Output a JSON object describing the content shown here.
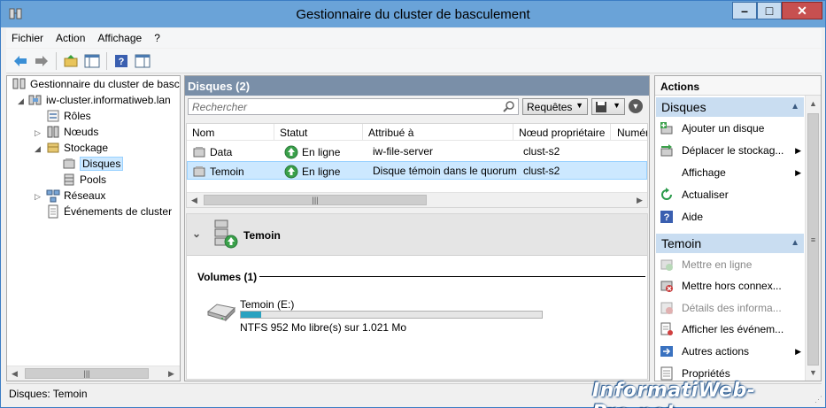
{
  "window": {
    "title": "Gestionnaire du cluster de basculement"
  },
  "menu": [
    "Fichier",
    "Action",
    "Affichage",
    "?"
  ],
  "tree": {
    "root": "Gestionnaire du cluster de basculement",
    "cluster": "iw-cluster.informatiweb.lan",
    "roles": "Rôles",
    "nodes": "Nœuds",
    "storage": "Stockage",
    "disks": "Disques",
    "pools": "Pools",
    "networks": "Réseaux",
    "events": "Événements de cluster"
  },
  "center": {
    "header": "Disques (2)",
    "search_placeholder": "Rechercher",
    "queries_label": "Requêtes",
    "columns": [
      "Nom",
      "Statut",
      "Attribué à",
      "Nœud propriétaire",
      "Numéro"
    ],
    "rows": [
      {
        "name": "Data",
        "status": "En ligne",
        "assigned": "iw-file-server",
        "owner": "clust-s2"
      },
      {
        "name": "Temoin",
        "status": "En ligne",
        "assigned": "Disque témoin dans le quorum",
        "owner": "clust-s2"
      }
    ]
  },
  "detail": {
    "name": "Temoin",
    "volumes_header": "Volumes (1)",
    "volume_name": "Temoin (E:)",
    "volume_info": "NTFS 952 Mo libre(s) sur 1.021 Mo",
    "used_fraction": 0.068
  },
  "actions": {
    "header": "Actions",
    "sections": [
      {
        "title": "Disques",
        "items": [
          {
            "label": "Ajouter un disque",
            "icon": "add-disk-icon",
            "enabled": true,
            "submenu": false
          },
          {
            "label": "Déplacer le stockag...",
            "icon": "move-storage-icon",
            "enabled": true,
            "submenu": true
          },
          {
            "label": "Affichage",
            "icon": "none",
            "enabled": true,
            "submenu": true
          },
          {
            "label": "Actualiser",
            "icon": "refresh-icon",
            "enabled": true,
            "submenu": false
          },
          {
            "label": "Aide",
            "icon": "help-icon",
            "enabled": true,
            "submenu": false
          }
        ]
      },
      {
        "title": "Temoin",
        "items": [
          {
            "label": "Mettre en ligne",
            "icon": "bring-online-icon",
            "enabled": false,
            "submenu": false
          },
          {
            "label": "Mettre hors connex...",
            "icon": "take-offline-icon",
            "enabled": true,
            "submenu": false
          },
          {
            "label": "Détails des informa...",
            "icon": "info-details-icon",
            "enabled": false,
            "submenu": false
          },
          {
            "label": "Afficher les événem...",
            "icon": "show-events-icon",
            "enabled": true,
            "submenu": false
          },
          {
            "label": "Autres actions",
            "icon": "more-actions-icon",
            "enabled": true,
            "submenu": true
          },
          {
            "label": "Propriétés",
            "icon": "properties-icon",
            "enabled": true,
            "submenu": false
          }
        ]
      }
    ]
  },
  "status": {
    "text": "Disques:  Temoin"
  },
  "watermark": "InformatiWeb-Pro.net"
}
